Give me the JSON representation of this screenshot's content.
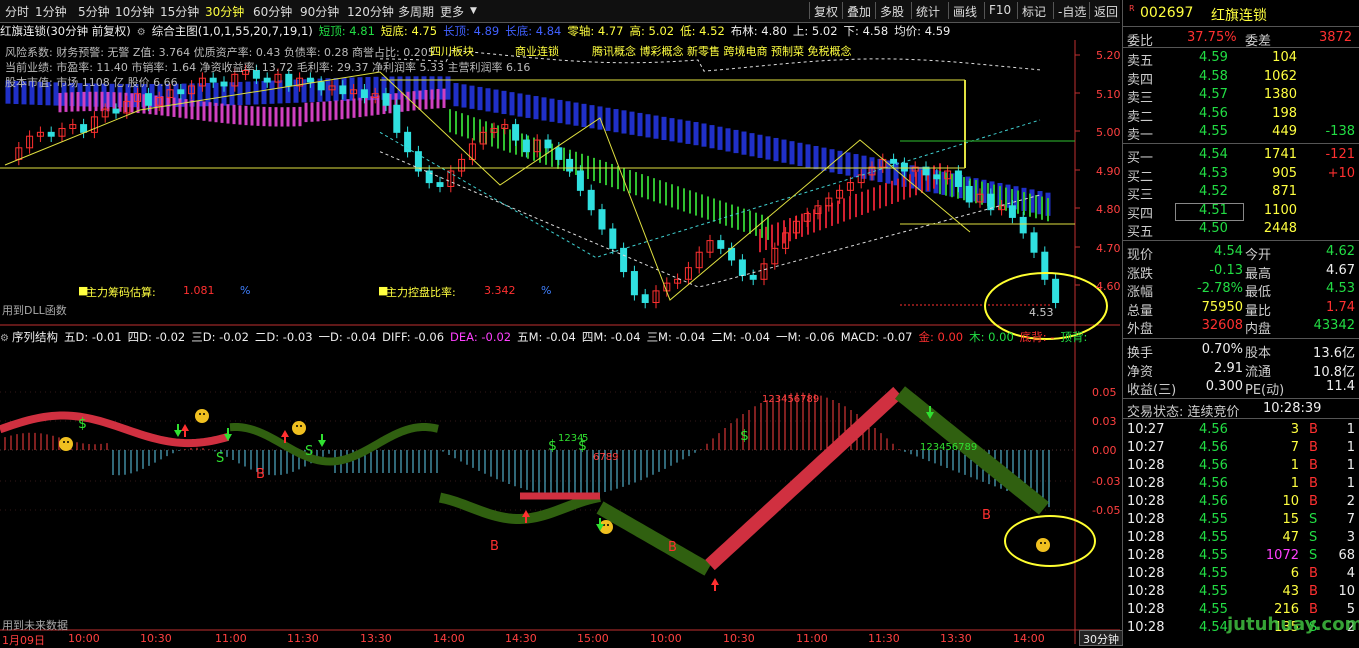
{
  "toolbar": {
    "timeframes": [
      "分时",
      "1分钟",
      "5分钟",
      "10分钟",
      "15分钟",
      "30分钟",
      "60分钟",
      "90分钟",
      "120分钟",
      "多周期",
      "更多"
    ],
    "active_timeframe": "30分钟",
    "buttons": [
      "复权",
      "叠加",
      "多股",
      "统计",
      "画线",
      "F10",
      "标记",
      "-自选",
      "返回"
    ]
  },
  "main_chart": {
    "stock_title": "红旗连锁(30分钟 前复权)",
    "indicator": "综合主图(1,0,1,55,20,7,19,1)",
    "params": [
      {
        "label": "短顶: 4.81",
        "color": "#22dd44"
      },
      {
        "label": "短底: 4.75",
        "color": "#ffff40"
      },
      {
        "label": "长顶: 4.89",
        "color": "#4060ff"
      },
      {
        "label": "长底: 4.84",
        "color": "#4060ff"
      },
      {
        "label": "零轴: 4.77",
        "color": "#ffff40"
      },
      {
        "label": "高: 5.02",
        "color": "#ffff40"
      },
      {
        "label": "低: 4.52",
        "color": "#ffff40"
      },
      {
        "label": "布林: 4.80",
        "color": "#eeeeee"
      },
      {
        "label": "上: 5.02",
        "color": "#eeeeee"
      },
      {
        "label": "下: 4.58",
        "color": "#eeeeee"
      },
      {
        "label": "均价: 4.59",
        "color": "#eeeeee"
      }
    ],
    "risk_line": "风险系数: 财务预警: 无警 Z值: 3.764 优质资产率: 0.43 负债率: 0.28 商誉占比: 0.205",
    "perf_line": "当前业绩: 市盈率: 11.40 市销率: 1.64 净资收益率: 13.72 毛利率: 29.37 净利润率 5.33 主营利润率 6.16",
    "market_line": "股本市值: 市场 1108 亿 股价 6.66",
    "concepts": [
      "四川板块",
      "商业连锁",
      "腾讯概念 博彩概念 新零售 跨境电商 预制菜 免税概念"
    ],
    "chip_estimate_label": "主力筹码估算:",
    "chip_estimate_value": "1.081",
    "control_ratio_label": "主力控盘比率:",
    "control_ratio_value": "3.342",
    "pct": "%",
    "dll_note": "用到DLL函数",
    "last_price_label": "4.53",
    "price_axis": [
      "5.20",
      "5.10",
      "5.00",
      "4.90",
      "4.80",
      "4.70",
      "4.60"
    ]
  },
  "sub_chart": {
    "title": "序列结构",
    "params": [
      {
        "label": "五D: -0.01",
        "color": "#eeeeee"
      },
      {
        "label": "四D: -0.02",
        "color": "#eeeeee"
      },
      {
        "label": "三D: -0.02",
        "color": "#eeeeee"
      },
      {
        "label": "二D: -0.03",
        "color": "#eeeeee"
      },
      {
        "label": "一D: -0.04",
        "color": "#eeeeee"
      },
      {
        "label": "DIFF: -0.06",
        "color": "#eeeeee"
      },
      {
        "label": "DEA: -0.02",
        "color": "#ff40ff"
      },
      {
        "label": "五M: -0.04",
        "color": "#eeeeee"
      },
      {
        "label": "四M: -0.04",
        "color": "#eeeeee"
      },
      {
        "label": "三M: -0.04",
        "color": "#eeeeee"
      },
      {
        "label": "二M: -0.04",
        "color": "#eeeeee"
      },
      {
        "label": "一M: -0.06",
        "color": "#eeeeee"
      },
      {
        "label": "MACD: -0.07",
        "color": "#eeeeee"
      },
      {
        "label": "金: 0.00",
        "color": "#ff3030"
      },
      {
        "label": "木: 0.00",
        "color": "#22dd44"
      },
      {
        "label": "底背: -",
        "color": "#ff3030"
      },
      {
        "label": "顶背:",
        "color": "#22dd44"
      }
    ],
    "axis": [
      "0.05",
      "0.03",
      "0.00",
      "-0.03",
      "-0.05"
    ],
    "future_note": "用到未来数据",
    "count_up": "1234",
    "count_up2": "5",
    "count_seq": "6789",
    "count_seq2": "123456789"
  },
  "time_axis": [
    "1月09日",
    "10:00",
    "10:30",
    "11:00",
    "11:30",
    "13:30",
    "14:00",
    "14:30",
    "15:00",
    "10:00",
    "10:30",
    "11:00",
    "11:30",
    "13:30",
    "14:00"
  ],
  "period_label": "30分钟",
  "quote": {
    "code": "002697",
    "name": "红旗连锁",
    "wei_bi_label": "委比",
    "wei_bi": "37.75%",
    "wei_cha_label": "委差",
    "wei_cha": "3872",
    "asks": [
      {
        "label": "卖五",
        "price": "4.59",
        "vol": "104",
        "chg": ""
      },
      {
        "label": "卖四",
        "price": "4.58",
        "vol": "1062",
        "chg": ""
      },
      {
        "label": "卖三",
        "price": "4.57",
        "vol": "1380",
        "chg": ""
      },
      {
        "label": "卖二",
        "price": "4.56",
        "vol": "198",
        "chg": ""
      },
      {
        "label": "卖一",
        "price": "4.55",
        "vol": "449",
        "chg": "-138"
      }
    ],
    "bids": [
      {
        "label": "买一",
        "price": "4.54",
        "vol": "1741",
        "chg": "-121"
      },
      {
        "label": "买二",
        "price": "4.53",
        "vol": "905",
        "chg": "+10"
      },
      {
        "label": "买三",
        "price": "4.52",
        "vol": "871",
        "chg": ""
      },
      {
        "label": "买四",
        "price": "4.51",
        "vol": "1100",
        "chg": ""
      },
      {
        "label": "买五",
        "price": "4.50",
        "vol": "2448",
        "chg": ""
      }
    ],
    "stats": [
      {
        "l1": "现价",
        "v1": "4.54",
        "c1": "#22dd44",
        "l2": "今开",
        "v2": "4.62",
        "c2": "#22dd44"
      },
      {
        "l1": "涨跌",
        "v1": "-0.13",
        "c1": "#22dd44",
        "l2": "最高",
        "v2": "4.67",
        "c2": "#eeeeee"
      },
      {
        "l1": "涨幅",
        "v1": "-2.78%",
        "c1": "#22dd44",
        "l2": "最低",
        "v2": "4.53",
        "c2": "#22dd44"
      },
      {
        "l1": "总量",
        "v1": "75950",
        "c1": "#ffff40",
        "l2": "量比",
        "v2": "1.74",
        "c2": "#ff3030"
      },
      {
        "l1": "外盘",
        "v1": "32608",
        "c1": "#ff3030",
        "l2": "内盘",
        "v2": "43342",
        "c2": "#22dd44"
      }
    ],
    "stats2": [
      {
        "l1": "换手",
        "v1": "0.70%",
        "l2": "股本",
        "v2": "13.6亿"
      },
      {
        "l1": "净资",
        "v1": "2.91",
        "l2": "流通",
        "v2": "10.8亿"
      },
      {
        "l1": "收益(三)",
        "v1": "0.300",
        "l2": "PE(动)",
        "v2": "11.4"
      }
    ],
    "trade_status_label": "交易状态: 连续竞价",
    "trade_time": "10:28:39",
    "ticks": [
      {
        "t": "10:27",
        "p": "4.56",
        "v": "3",
        "s": "B",
        "n": "1"
      },
      {
        "t": "10:27",
        "p": "4.56",
        "v": "7",
        "s": "B",
        "n": "1"
      },
      {
        "t": "10:28",
        "p": "4.56",
        "v": "1",
        "s": "B",
        "n": "1"
      },
      {
        "t": "10:28",
        "p": "4.56",
        "v": "1",
        "s": "B",
        "n": "1"
      },
      {
        "t": "10:28",
        "p": "4.56",
        "v": "10",
        "s": "B",
        "n": "2"
      },
      {
        "t": "10:28",
        "p": "4.55",
        "v": "15",
        "s": "S",
        "n": "7"
      },
      {
        "t": "10:28",
        "p": "4.55",
        "v": "47",
        "s": "S",
        "n": "3"
      },
      {
        "t": "10:28",
        "p": "4.55",
        "v": "1072",
        "s": "S",
        "n": "68"
      },
      {
        "t": "10:28",
        "p": "4.55",
        "v": "6",
        "s": "B",
        "n": "4"
      },
      {
        "t": "10:28",
        "p": "4.55",
        "v": "43",
        "s": "B",
        "n": "10"
      },
      {
        "t": "10:28",
        "p": "4.55",
        "v": "216",
        "s": "B",
        "n": "5"
      },
      {
        "t": "10:28",
        "p": "4.54",
        "v": "135",
        "s": "S",
        "n": "2"
      }
    ]
  },
  "watermark": "jutuhuay.com"
}
